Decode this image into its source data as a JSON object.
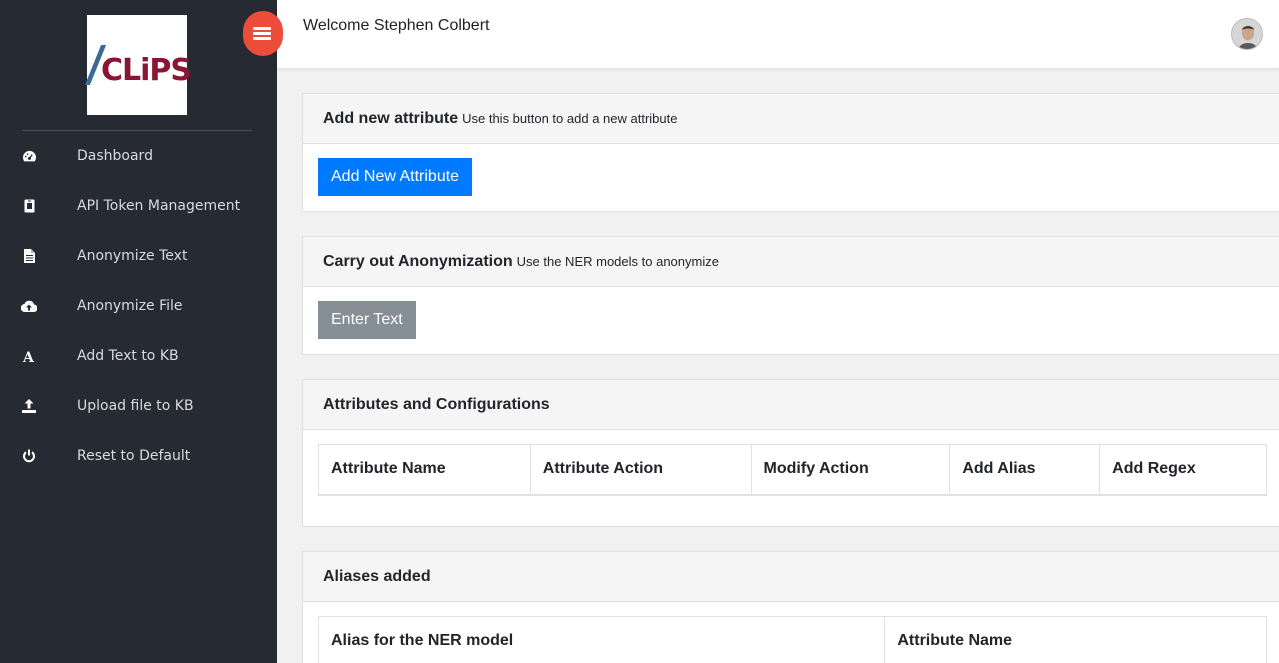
{
  "logo": {
    "text": "CLiPS"
  },
  "sidebar": {
    "items": [
      {
        "label": "Dashboard",
        "icon": "dashboard-icon"
      },
      {
        "label": "API Token Management",
        "icon": "id-badge-icon"
      },
      {
        "label": "Anonymize Text",
        "icon": "file-text-icon"
      },
      {
        "label": "Anonymize File",
        "icon": "cloud-upload-icon"
      },
      {
        "label": "Add Text to KB",
        "icon": "font-a-icon"
      },
      {
        "label": "Upload file to KB",
        "icon": "upload-icon"
      },
      {
        "label": "Reset to Default",
        "icon": "power-icon"
      }
    ]
  },
  "header": {
    "welcome": "Welcome Stephen Colbert"
  },
  "cards": {
    "add_attribute": {
      "title": "Add new attribute",
      "subtitle": "Use this button to add a new attribute",
      "button": "Add New Attribute"
    },
    "anonymization": {
      "title": "Carry out Anonymization",
      "subtitle": "Use the NER models to anonymize",
      "button": "Enter Text"
    },
    "attributes": {
      "title": "Attributes and Configurations",
      "columns": [
        "Attribute Name",
        "Attribute Action",
        "Modify Action",
        "Add Alias",
        "Add Regex"
      ]
    },
    "aliases": {
      "title": "Aliases added",
      "columns": [
        "Alias for the NER model",
        "Attribute Name"
      ]
    }
  },
  "colors": {
    "sidebar_bg": "#262a33",
    "toggle": "#ec4c3a",
    "primary": "#007bff",
    "secondary": "#868e96",
    "logo_text": "#8a1535"
  }
}
